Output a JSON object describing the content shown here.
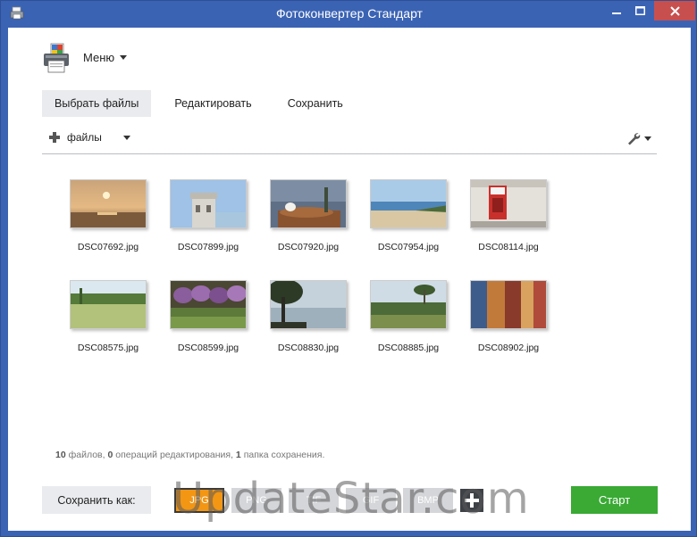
{
  "window": {
    "title": "Фотоконвертер Стандарт"
  },
  "menu": {
    "label": "Меню"
  },
  "tabs": [
    {
      "label": "Выбрать файлы",
      "active": true
    },
    {
      "label": "Редактировать",
      "active": false
    },
    {
      "label": "Сохранить",
      "active": false
    }
  ],
  "toolbar": {
    "add_label": "файлы"
  },
  "files": [
    {
      "name": "DSC07692.jpg",
      "icon": "sunset-photo"
    },
    {
      "name": "DSC07899.jpg",
      "icon": "tower-photo"
    },
    {
      "name": "DSC07920.jpg",
      "icon": "bird-nest-photo"
    },
    {
      "name": "DSC07954.jpg",
      "icon": "beach-photo"
    },
    {
      "name": "DSC08114.jpg",
      "icon": "red-sign-photo"
    },
    {
      "name": "DSC08575.jpg",
      "icon": "field-photo"
    },
    {
      "name": "DSC08599.jpg",
      "icon": "eggplants-photo"
    },
    {
      "name": "DSC08830.jpg",
      "icon": "tree-lake-photo"
    },
    {
      "name": "DSC08885.jpg",
      "icon": "palms-photo"
    },
    {
      "name": "DSC08902.jpg",
      "icon": "fabric-photo"
    }
  ],
  "stats": {
    "files_count": "10",
    "files_text": "файлов,",
    "edits_count": "0",
    "edits_text": "операций редактирования,",
    "folders_count": "1",
    "folders_text": "папка сохранения."
  },
  "save_as": {
    "label": "Сохранить как:"
  },
  "formats": [
    {
      "label": "JPG",
      "active": true
    },
    {
      "label": "PNG",
      "active": false
    },
    {
      "label": "TIF",
      "active": false
    },
    {
      "label": "GIF",
      "active": false
    },
    {
      "label": "BMP",
      "active": false
    }
  ],
  "start": {
    "label": "Старт"
  },
  "watermark": {
    "text": "UpdateStar.com"
  },
  "colors": {
    "frame": "#3b63b4",
    "close": "#c7504e",
    "format_active": "#f29614",
    "start": "#3aaa35"
  }
}
